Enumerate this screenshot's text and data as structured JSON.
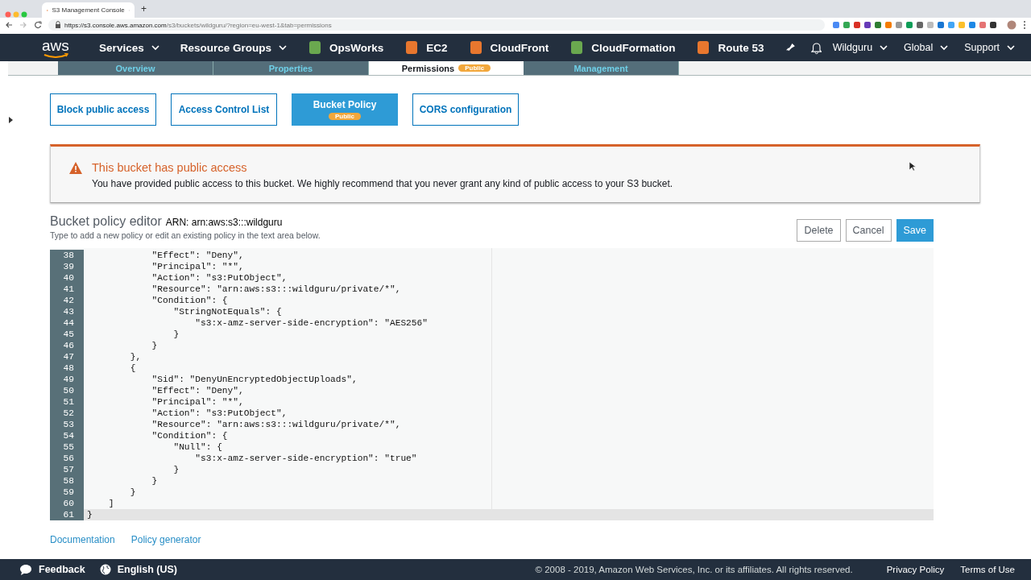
{
  "browser": {
    "tab_title": "S3 Management Console",
    "new_tab": "+",
    "url_host": "https://s3.console.aws.amazon.com",
    "url_path": "/s3/buckets/wildguru/?region=eu-west-1&tab=permissions"
  },
  "nav": {
    "logo": "aws",
    "menus": [
      {
        "label": "Services",
        "kind": "menu"
      },
      {
        "label": "Resource Groups",
        "kind": "menu"
      },
      {
        "label": "OpsWorks",
        "kind": "service",
        "color": "#6aa84f"
      },
      {
        "label": "EC2",
        "kind": "service",
        "color": "#e8772e"
      },
      {
        "label": "CloudFront",
        "kind": "service",
        "color": "#e8772e"
      },
      {
        "label": "CloudFormation",
        "kind": "service",
        "color": "#6aa84f"
      },
      {
        "label": "Route 53",
        "kind": "service",
        "color": "#e8772e"
      }
    ],
    "right": [
      {
        "label": "Wildguru"
      },
      {
        "label": "Global"
      },
      {
        "label": "Support"
      }
    ]
  },
  "bucket_tabs": [
    {
      "label": "Overview",
      "selected": false
    },
    {
      "label": "Properties",
      "selected": false
    },
    {
      "label": "Permissions",
      "selected": true,
      "badge": "Public"
    },
    {
      "label": "Management",
      "selected": false
    }
  ],
  "permission_tabs": [
    {
      "label": "Block public access",
      "selected": false
    },
    {
      "label": "Access Control List",
      "selected": false
    },
    {
      "label": "Bucket Policy",
      "selected": true,
      "badge": "Public"
    },
    {
      "label": "CORS configuration",
      "selected": false
    }
  ],
  "alert": {
    "title": "This bucket has public access",
    "message": "You have provided public access to this bucket. We highly recommend that you never grant any kind of public access to your S3 bucket."
  },
  "editor": {
    "title": "Bucket policy editor",
    "arn": "ARN: arn:aws:s3:::wildguru",
    "hint": "Type to add a new policy or edit an existing policy in the text area below.",
    "buttons": [
      {
        "label": "Delete",
        "kind": "secondary"
      },
      {
        "label": "Cancel",
        "kind": "secondary"
      },
      {
        "label": "Save",
        "kind": "primary"
      }
    ],
    "lines": [
      {
        "number": "38",
        "text": "            \"Effect\": \"Deny\",",
        "selected": false
      },
      {
        "number": "39",
        "text": "            \"Principal\": \"*\",",
        "selected": false
      },
      {
        "number": "40",
        "text": "            \"Action\": \"s3:PutObject\",",
        "selected": false
      },
      {
        "number": "41",
        "text": "            \"Resource\": \"arn:aws:s3:::wildguru/private/*\",",
        "selected": false
      },
      {
        "number": "42",
        "text": "            \"Condition\": {",
        "selected": false
      },
      {
        "number": "43",
        "text": "                \"StringNotEquals\": {",
        "selected": false
      },
      {
        "number": "44",
        "text": "                    \"s3:x-amz-server-side-encryption\": \"AES256\"",
        "selected": false
      },
      {
        "number": "45",
        "text": "                }",
        "selected": false
      },
      {
        "number": "46",
        "text": "            }",
        "selected": false
      },
      {
        "number": "47",
        "text": "        },",
        "selected": false
      },
      {
        "number": "48",
        "text": "        {",
        "selected": false
      },
      {
        "number": "49",
        "text": "            \"Sid\": \"DenyUnEncryptedObjectUploads\",",
        "selected": false
      },
      {
        "number": "50",
        "text": "            \"Effect\": \"Deny\",",
        "selected": false
      },
      {
        "number": "51",
        "text": "            \"Principal\": \"*\",",
        "selected": false
      },
      {
        "number": "52",
        "text": "            \"Action\": \"s3:PutObject\",",
        "selected": false
      },
      {
        "number": "53",
        "text": "            \"Resource\": \"arn:aws:s3:::wildguru/private/*\",",
        "selected": false
      },
      {
        "number": "54",
        "text": "            \"Condition\": {",
        "selected": false
      },
      {
        "number": "55",
        "text": "                \"Null\": {",
        "selected": false
      },
      {
        "number": "56",
        "text": "                    \"s3:x-amz-server-side-encryption\": \"true\"",
        "selected": false
      },
      {
        "number": "57",
        "text": "                }",
        "selected": false
      },
      {
        "number": "58",
        "text": "            }",
        "selected": false
      },
      {
        "number": "59",
        "text": "        }",
        "selected": false
      },
      {
        "number": "60",
        "text": "    ]",
        "selected": false
      },
      {
        "number": "61",
        "text": "}",
        "selected": true
      }
    ],
    "links": [
      "Documentation",
      "Policy generator"
    ]
  },
  "footer": {
    "feedback": "Feedback",
    "language": "English (US)",
    "copyright": "© 2008 - 2019, Amazon Web Services, Inc. or its affiliates. All rights reserved.",
    "links": [
      "Privacy Policy",
      "Terms of Use"
    ]
  }
}
